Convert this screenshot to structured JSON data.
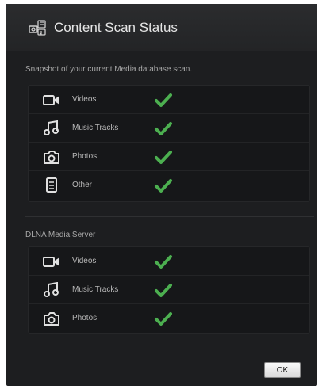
{
  "dialog": {
    "title": "Content Scan Status",
    "intro": "Snapshot of your current Media database scan.",
    "accent_color": "#4caf50"
  },
  "scan": {
    "items": [
      {
        "label": "Videos",
        "icon": "video-camera-icon",
        "status": "check"
      },
      {
        "label": "Music Tracks",
        "icon": "music-note-icon",
        "status": "check"
      },
      {
        "label": "Photos",
        "icon": "camera-icon",
        "status": "check"
      },
      {
        "label": "Other",
        "icon": "document-icon",
        "status": "check"
      }
    ]
  },
  "dlna": {
    "title": "DLNA Media Server",
    "items": [
      {
        "label": "Videos",
        "icon": "video-camera-icon",
        "status": "check"
      },
      {
        "label": "Music Tracks",
        "icon": "music-note-icon",
        "status": "check"
      },
      {
        "label": "Photos",
        "icon": "camera-icon",
        "status": "check"
      }
    ]
  },
  "buttons": {
    "ok": "OK"
  }
}
